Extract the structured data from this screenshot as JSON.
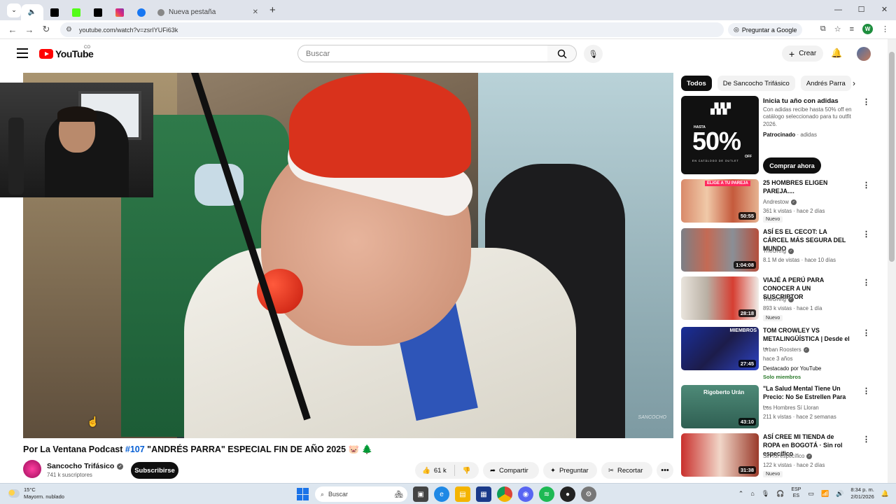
{
  "browser": {
    "tabs": [
      {
        "icon": "speaker-icon",
        "color": "#ffffff"
      },
      {
        "icon": "tiktok-icon",
        "color": "#000000"
      },
      {
        "icon": "kick-icon",
        "color": "#53fc18"
      },
      {
        "icon": "x-icon",
        "color": "#000000"
      },
      {
        "icon": "instagram-icon",
        "color": "#e1306c"
      },
      {
        "icon": "facebook-icon",
        "color": "#1877f2"
      }
    ],
    "new_tab_title": "Nueva pestaña",
    "url": "youtube.com/watch?v=zsrIYUFi63k",
    "ask_google": "Preguntar a Google",
    "profile_initial": "W"
  },
  "header": {
    "logo_text": "YouTube",
    "country_code": "CO",
    "search_placeholder": "Buscar",
    "create_label": "Crear"
  },
  "video": {
    "title_prefix": "Por La Ventana Podcast ",
    "title_tag": "#107",
    "title_rest": " \"ANDRÉS PARRA\" ESPECIAL FIN DE AÑO 2025 🐷 🌲",
    "watermark": "SANCOCHO"
  },
  "channel": {
    "name": "Sancocho Trifásico",
    "subscribers": "741 k suscriptores",
    "subscribe_label": "Subscribirse"
  },
  "actions": {
    "likes": "61 k",
    "share": "Compartir",
    "ask": "Preguntar",
    "clip": "Recortar"
  },
  "sidebar": {
    "chips": [
      "Todos",
      "De Sancocho Trifásico",
      "Andrés Parra"
    ],
    "ad": {
      "title": "Inicia tu año con adidas",
      "description": "Con adidas recibe hasta 50% off en catálogo seleccionado para tu outfit 2026.",
      "sponsored": "Patrocinado",
      "advertiser": "adidas",
      "cta": "Comprar ahora",
      "thumb_hasta": "HASTA",
      "thumb_big": "50%",
      "thumb_off": "OFF",
      "thumb_small": "EN CATÁLOGO DE OUTLET"
    },
    "videos": [
      {
        "title": "25 HOMBRES ELIGEN PAREJA....",
        "channel": "Andrestow",
        "meta": "361 k vistas · hace 2 días",
        "badge": "Nuevo",
        "duration": "50:55",
        "thumb_label": "ELIGE A TU PAREJA"
      },
      {
        "title": "ASÍ ES EL CECOT: LA CÁRCEL MÁS SEGURA DEL MUNDO",
        "channel": "TheGrefg",
        "meta": "8.1 M de vistas · hace 10 días",
        "duration": "1:04:08"
      },
      {
        "title": "VIAJÉ A PERÚ PARA CONOCER A UN SUSCRIPTOR",
        "channel": "TheGrefg",
        "meta": "893 k vistas · hace 1 día",
        "badge": "Nuevo",
        "duration": "28:18"
      },
      {
        "title": "TOM CROWLEY VS METALINGÜÍSTICA | Desde el ...",
        "channel": "Urban Roosters",
        "meta": "hace 3 años",
        "featured": "Destacado por YouTube",
        "members": "Solo miembros",
        "duration": "27:45",
        "thumb_label": "MIEMBROS"
      },
      {
        "title": "\"La Salud Mental Tiene Un Precio: No Se Estrellen Para ...",
        "channel": "Los Hombres Sí Lloran",
        "meta": "211 k vistas · hace 2 semanas",
        "duration": "43:10",
        "thumb_label": "Rigoberto Urán"
      },
      {
        "title": "ASÍ CREE MI TIENDA de ROPA en BOGOTÁ · Sin rol específico",
        "channel": "Sin rol específico",
        "meta": "122 k vistas · hace 2 días",
        "badge": "Nuevo",
        "duration": "31:38"
      }
    ]
  },
  "taskbar": {
    "temperature": "15°C",
    "weather": "Mayorm. nublado",
    "search": "Buscar",
    "lang_top": "ESP",
    "lang_bottom": "ES",
    "time": "8:34 p. m.",
    "date": "2/01/2026"
  },
  "colors": {
    "youtube_red": "#ff0000",
    "link_blue": "#065fd4",
    "chrome_bg": "#dfe3eb"
  }
}
